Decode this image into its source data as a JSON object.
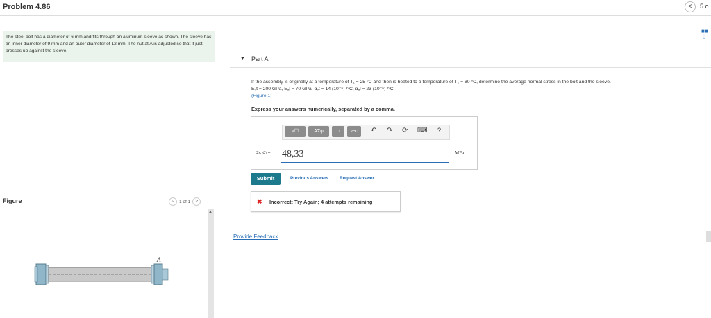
{
  "header": {
    "title": "Problem 4.86",
    "pager_text": "5 o"
  },
  "statement": {
    "text": "The steel bolt has a diameter of 6 mm and fits through an aluminum sleeve as shown. The sleeve has an inner diameter of 9 mm and an outer diameter of 12 mm. The nut at A is adjusted so that it just presses up against the sleeve."
  },
  "figure": {
    "label": "Figure",
    "pager": "1 of 1",
    "point_label": "A"
  },
  "part": {
    "label": "Part A",
    "question_line1": "If the assembly is originally at a temperature of T₁ = 25 °C and then is heated to a temperature of T₂ = 80 °C, determine the average normal stress in the bolt and the sleeve.",
    "question_line2": "Eₛt = 200 GPa, Eₐl = 70 GPa, αₛt = 14 (10⁻⁶) /°C, αₐl = 23 (10⁻⁶) /°C.",
    "figure_link": "(Figure 1)",
    "instruction": "Express your answers numerically, separated by a comma."
  },
  "toolbar": {
    "templates": "√☐",
    "greek": "AΣφ",
    "arrows": "↓↑",
    "vec": "vec",
    "undo": "↶",
    "redo": "↷",
    "reset": "⟳",
    "keyboard": "⌨",
    "help": "?"
  },
  "answer": {
    "label": "σₛ, σₗ =",
    "value": "48,33",
    "unit": "MPa"
  },
  "actions": {
    "submit": "Submit",
    "previous": "Previous Answers",
    "request": "Request Answer"
  },
  "feedback": {
    "icon": "✖",
    "text": "Incorrect; Try Again; 4 attempts remaining"
  },
  "provide_feedback": "Provide Feedback",
  "colors": {
    "accent": "#2a6fb6",
    "submit": "#1c7a8c",
    "error": "#dd2222",
    "statement_bg": "#eaf4ec"
  }
}
